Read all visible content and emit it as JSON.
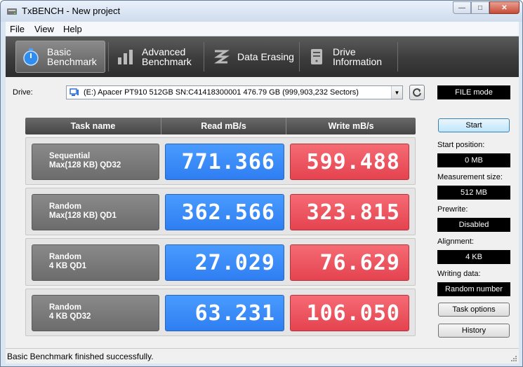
{
  "window": {
    "title": "TxBENCH - New project",
    "minimize_icon": "minimize-icon",
    "maximize_icon": "maximize-icon",
    "close_icon": "close-icon"
  },
  "menu": [
    "File",
    "View",
    "Help"
  ],
  "toolbar": [
    {
      "line1": "Basic",
      "line2": "Benchmark",
      "icon": "stopwatch-icon",
      "active": true
    },
    {
      "line1": "Advanced",
      "line2": "Benchmark",
      "icon": "bar-chart-icon",
      "active": false
    },
    {
      "line1": "Data Erasing",
      "line2": "",
      "icon": "eraser-icon",
      "active": false
    },
    {
      "line1": "Drive",
      "line2": "Information",
      "icon": "drive-icon",
      "active": false
    }
  ],
  "drive": {
    "label": "Drive:",
    "value": "(E:) Apacer PT910 512GB SN:C41418300001  476.79 GB (999,903,232 Sectors)",
    "mode": "FILE mode"
  },
  "table": {
    "headers": [
      "Task name",
      "Read mB/s",
      "Write mB/s"
    ],
    "rows": [
      {
        "line1": "Sequential",
        "line2": "Max(128 KB) QD32",
        "read": "771.366",
        "write": "599.488"
      },
      {
        "line1": "Random",
        "line2": "Max(128 KB) QD1",
        "read": "362.566",
        "write": "323.815"
      },
      {
        "line1": "Random",
        "line2": "4 KB QD1",
        "read": "27.029",
        "write": "76.629"
      },
      {
        "line1": "Random",
        "line2": "4 KB QD32",
        "read": "63.231",
        "write": "106.050"
      }
    ]
  },
  "side": {
    "start_label": "Start",
    "start_position_label": "Start position:",
    "start_position_value": "0 MB",
    "measurement_size_label": "Measurement size:",
    "measurement_size_value": "512 MB",
    "prewrite_label": "Prewrite:",
    "prewrite_value": "Disabled",
    "alignment_label": "Alignment:",
    "alignment_value": "4 KB",
    "writing_data_label": "Writing data:",
    "writing_data_value": "Random number",
    "task_options_label": "Task options",
    "history_label": "History"
  },
  "status": "Basic Benchmark finished successfully.",
  "colors": {
    "read": "#2e7ef2",
    "write": "#e4434f",
    "toolbar": "#3c3c3c"
  }
}
